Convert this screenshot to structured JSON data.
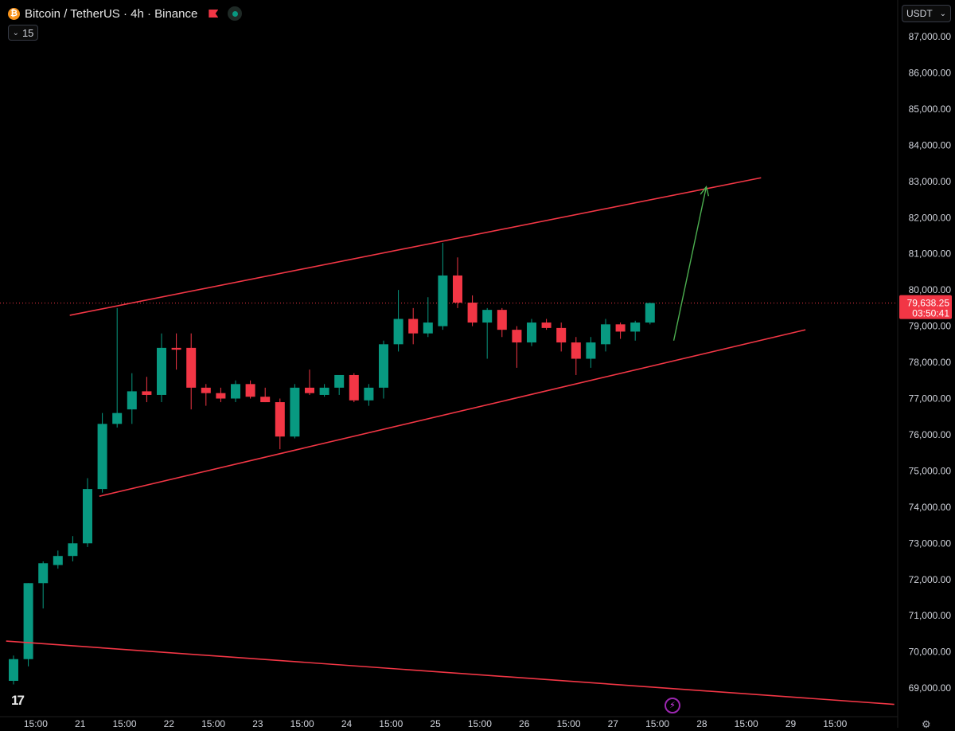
{
  "header": {
    "symbol_title": "Bitcoin / TetherUS · 4h · Binance",
    "coin_icon": "bitcoin-icon",
    "collapse_label": "15",
    "currency": "USDT"
  },
  "colors": {
    "up": "#089981",
    "down": "#f23645",
    "trendline": "#f23645",
    "arrow": "#4caf50",
    "background": "#000000",
    "axis_text": "#d1d4dc"
  },
  "chart_data": {
    "type": "candlestick",
    "title": "Bitcoin / TetherUS · 4h · Binance",
    "timeframe": "4h",
    "y_axis": {
      "ticks": [
        "87,000.00",
        "86,000.00",
        "85,000.00",
        "84,000.00",
        "83,000.00",
        "82,000.00",
        "81,000.00",
        "80,000.00",
        "79,000.00",
        "78,000.00",
        "77,000.00",
        "76,000.00",
        "75,000.00",
        "74,000.00",
        "73,000.00",
        "72,000.00",
        "71,000.00",
        "70,000.00",
        "69,000.00"
      ],
      "ylim": [
        68300,
        87500
      ],
      "position": "right"
    },
    "x_axis": {
      "ticks": [
        {
          "label": "15:00",
          "bar": 1.5
        },
        {
          "label": "21",
          "bar": 4.5
        },
        {
          "label": "15:00",
          "bar": 7.5
        },
        {
          "label": "22",
          "bar": 10.5
        },
        {
          "label": "15:00",
          "bar": 13.5
        },
        {
          "label": "23",
          "bar": 16.5
        },
        {
          "label": "15:00",
          "bar": 19.5
        },
        {
          "label": "24",
          "bar": 22.5
        },
        {
          "label": "15:00",
          "bar": 25.5
        },
        {
          "label": "25",
          "bar": 28.5
        },
        {
          "label": "15:00",
          "bar": 31.5
        },
        {
          "label": "26",
          "bar": 34.5
        },
        {
          "label": "15:00",
          "bar": 37.5
        },
        {
          "label": "27",
          "bar": 40.5
        },
        {
          "label": "15:00",
          "bar": 43.5
        },
        {
          "label": "28",
          "bar": 46.5
        },
        {
          "label": "15:00",
          "bar": 49.5
        },
        {
          "label": "29",
          "bar": 52.5
        },
        {
          "label": "15:00",
          "bar": 55.5
        }
      ]
    },
    "candles": [
      {
        "o": 69200,
        "h": 69900,
        "l": 69100,
        "c": 69800
      },
      {
        "o": 69800,
        "h": 71900,
        "l": 69600,
        "c": 71900
      },
      {
        "o": 71900,
        "h": 72500,
        "l": 71200,
        "c": 72450
      },
      {
        "o": 72400,
        "h": 72800,
        "l": 72300,
        "c": 72650
      },
      {
        "o": 72650,
        "h": 73200,
        "l": 72500,
        "c": 73000
      },
      {
        "o": 73000,
        "h": 74800,
        "l": 72900,
        "c": 74500
      },
      {
        "o": 74500,
        "h": 76600,
        "l": 74400,
        "c": 76300
      },
      {
        "o": 76300,
        "h": 79500,
        "l": 76200,
        "c": 76600
      },
      {
        "o": 76700,
        "h": 77700,
        "l": 76300,
        "c": 77200
      },
      {
        "o": 77200,
        "h": 77600,
        "l": 76900,
        "c": 77100
      },
      {
        "o": 77100,
        "h": 78800,
        "l": 76900,
        "c": 78400
      },
      {
        "o": 78400,
        "h": 78800,
        "l": 77800,
        "c": 78350
      },
      {
        "o": 78400,
        "h": 78800,
        "l": 76700,
        "c": 77300
      },
      {
        "o": 77300,
        "h": 77400,
        "l": 76800,
        "c": 77150
      },
      {
        "o": 77150,
        "h": 77300,
        "l": 76900,
        "c": 77000
      },
      {
        "o": 77000,
        "h": 77500,
        "l": 76900,
        "c": 77400
      },
      {
        "o": 77400,
        "h": 77500,
        "l": 77000,
        "c": 77050
      },
      {
        "o": 77050,
        "h": 77300,
        "l": 76900,
        "c": 76900
      },
      {
        "o": 76900,
        "h": 77000,
        "l": 75600,
        "c": 75950
      },
      {
        "o": 75950,
        "h": 77400,
        "l": 75900,
        "c": 77300
      },
      {
        "o": 77300,
        "h": 77800,
        "l": 77100,
        "c": 77150
      },
      {
        "o": 77100,
        "h": 77400,
        "l": 77050,
        "c": 77300
      },
      {
        "o": 77300,
        "h": 77600,
        "l": 77100,
        "c": 77650
      },
      {
        "o": 77650,
        "h": 77700,
        "l": 76900,
        "c": 76950
      },
      {
        "o": 76950,
        "h": 77400,
        "l": 76800,
        "c": 77300
      },
      {
        "o": 77300,
        "h": 78600,
        "l": 77000,
        "c": 78500
      },
      {
        "o": 78500,
        "h": 80000,
        "l": 78300,
        "c": 79200
      },
      {
        "o": 79200,
        "h": 79500,
        "l": 78500,
        "c": 78800
      },
      {
        "o": 78800,
        "h": 79800,
        "l": 78700,
        "c": 79100
      },
      {
        "o": 79000,
        "h": 81300,
        "l": 78900,
        "c": 80400
      },
      {
        "o": 80400,
        "h": 80900,
        "l": 79500,
        "c": 79650
      },
      {
        "o": 79650,
        "h": 79850,
        "l": 79000,
        "c": 79100
      },
      {
        "o": 79100,
        "h": 79500,
        "l": 78100,
        "c": 79450
      },
      {
        "o": 79450,
        "h": 79500,
        "l": 78700,
        "c": 78900
      },
      {
        "o": 78900,
        "h": 79000,
        "l": 77850,
        "c": 78550
      },
      {
        "o": 78550,
        "h": 79200,
        "l": 78450,
        "c": 79100
      },
      {
        "o": 79100,
        "h": 79200,
        "l": 78900,
        "c": 78950
      },
      {
        "o": 78950,
        "h": 79100,
        "l": 78300,
        "c": 78550
      },
      {
        "o": 78550,
        "h": 78700,
        "l": 77650,
        "c": 78100
      },
      {
        "o": 78100,
        "h": 78700,
        "l": 77850,
        "c": 78550
      },
      {
        "o": 78500,
        "h": 79200,
        "l": 78300,
        "c": 79050
      },
      {
        "o": 79050,
        "h": 79100,
        "l": 78650,
        "c": 78850
      },
      {
        "o": 78850,
        "h": 79150,
        "l": 78600,
        "c": 79100
      },
      {
        "o": 79100,
        "h": 79650,
        "l": 79050,
        "c": 79638.25
      }
    ],
    "last_price": {
      "value": 79638.25,
      "label": "79,638.25",
      "countdown": "03:50:41"
    },
    "trendlines": [
      {
        "name": "upper-channel",
        "from": {
          "bar": 3.8,
          "price": 79300
        },
        "to": {
          "bar": 50.5,
          "price": 83100
        }
      },
      {
        "name": "lower-channel",
        "from": {
          "bar": 5.8,
          "price": 74300
        },
        "to": {
          "bar": 53.5,
          "price": 78900
        }
      },
      {
        "name": "lower-long-trend",
        "from": {
          "bar": -0.5,
          "price": 70300
        },
        "to": {
          "bar": 59.5,
          "price": 68550
        }
      }
    ],
    "projection_arrow": {
      "from": {
        "bar": 44.6,
        "price": 78600
      },
      "to": {
        "bar": 46.8,
        "price": 82850
      }
    },
    "grid": false,
    "legend": "none"
  },
  "footer": {
    "logo": "tradingview-logo",
    "bolt_icon": "lightning-icon",
    "settings_icon": "gear-icon"
  }
}
